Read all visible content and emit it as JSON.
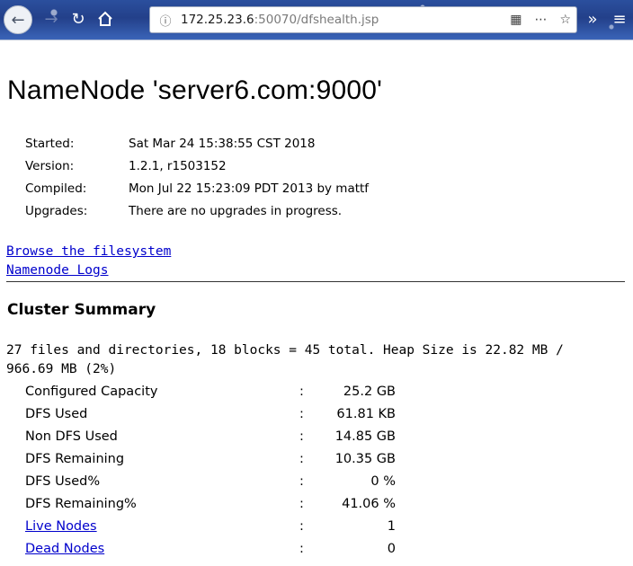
{
  "browser": {
    "url_host": "172.25.23.6",
    "url_rest": ":50070/dfshealth.jsp"
  },
  "page": {
    "title": "NameNode 'server6.com:9000'",
    "info": [
      {
        "label": "Started:",
        "value": "Sat Mar 24 15:38:55 CST 2018"
      },
      {
        "label": "Version:",
        "value": "1.2.1, r1503152"
      },
      {
        "label": "Compiled:",
        "value": "Mon Jul 22 15:23:09 PDT 2013 by mattf"
      },
      {
        "label": "Upgrades:",
        "value": "There are no upgrades in progress."
      }
    ],
    "links": {
      "browse": "Browse the filesystem",
      "logs": "Namenode Logs"
    },
    "cluster_heading": "Cluster Summary",
    "summary_text": "27 files and directories, 18 blocks = 45 total. Heap Size is 22.82 MB / 966.69 MB (2%)",
    "stats": [
      {
        "label": "Configured Capacity",
        "colon": ":",
        "value": "25.2 GB"
      },
      {
        "label": "DFS Used",
        "colon": ":",
        "value": "61.81 KB"
      },
      {
        "label": "Non DFS Used",
        "colon": ":",
        "value": "14.85 GB"
      },
      {
        "label": "DFS Remaining",
        "colon": ":",
        "value": "10.35 GB"
      },
      {
        "label": "DFS Used%",
        "colon": ":",
        "value": "0 %"
      },
      {
        "label": "DFS Remaining%",
        "colon": ":",
        "value": "41.06 %"
      },
      {
        "label": "Live Nodes",
        "colon": ":",
        "value": "1"
      },
      {
        "label": "Dead Nodes",
        "colon": ":",
        "value": "0"
      }
    ]
  }
}
